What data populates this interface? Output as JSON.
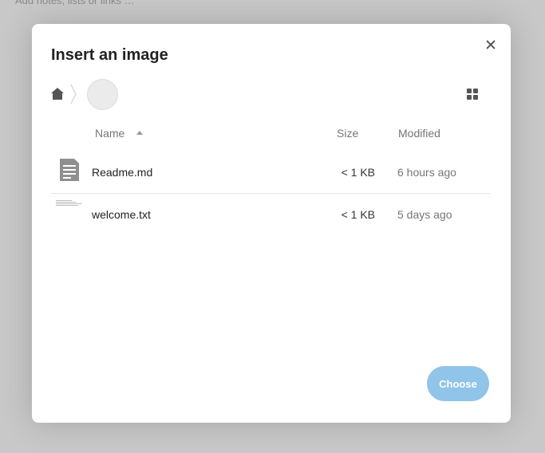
{
  "background": {
    "hint_text": "Add notes, lists or links …"
  },
  "dialog": {
    "title": "Insert an image",
    "close_icon": "close-icon",
    "breadcrumb": {
      "home_icon": "home-icon",
      "separator_icon": "chevron-right-icon"
    },
    "view_toggle_icon": "grid-view-icon",
    "columns": {
      "name": "Name",
      "size": "Size",
      "modified": "Modified"
    },
    "files": [
      {
        "name": "Readme.md",
        "size": "< 1 KB",
        "modified": "6 hours ago",
        "icon": "text-file-icon"
      },
      {
        "name": "welcome.txt",
        "size": "< 1 KB",
        "modified": "5 days ago",
        "icon": "text-thumbnail"
      }
    ],
    "choose_label": "Choose"
  },
  "colors": {
    "accent": "#90c4e8",
    "backdrop": "#c8c8c8"
  }
}
